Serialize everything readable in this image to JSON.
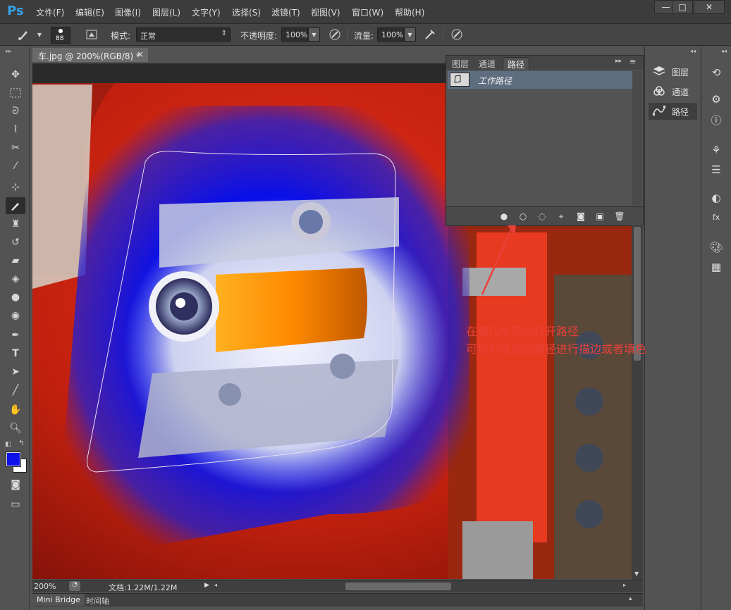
{
  "app": {
    "logo": "Ps"
  },
  "menu": [
    "文件(F)",
    "编辑(E)",
    "图像(I)",
    "图层(L)",
    "文字(Y)",
    "选择(S)",
    "滤镜(T)",
    "视图(V)",
    "窗口(W)",
    "帮助(H)"
  ],
  "window_controls": {
    "minimize": "—",
    "maximize": "□",
    "close": "✕"
  },
  "options": {
    "brush_size": "88",
    "mode_label": "模式:",
    "mode_value": "正常",
    "opacity_label": "不透明度:",
    "opacity_value": "100%",
    "flow_label": "流量:",
    "flow_value": "100%"
  },
  "document": {
    "tab_title": "车.jpg @ 200%(RGB/8) *",
    "tab_close": "×",
    "zoom": "200%",
    "doc_info": "文档:1.22M/1.22M"
  },
  "paths_panel": {
    "tabs": [
      "图层",
      "通道",
      "路径"
    ],
    "active_tab": "路径",
    "path_name": "工作路径",
    "footer_icons": [
      "fill-path",
      "stroke-path",
      "load-selection",
      "make-work-path",
      "add-mask",
      "new-path",
      "delete-path"
    ]
  },
  "dock": {
    "items": [
      {
        "label": "图层",
        "icon": "layers-icon"
      },
      {
        "label": "通道",
        "icon": "channels-icon"
      },
      {
        "label": "路径",
        "icon": "paths-icon"
      }
    ]
  },
  "bottom_tabs": [
    "Mini Bridge",
    "时间轴"
  ],
  "annotation": {
    "line1": "在窗口中可以打开路径",
    "line2": "可以对绘话的路径进行描边或者填色"
  },
  "colors": {
    "foreground": "#1010e8",
    "background": "#ffffff",
    "annotation": "#e8413a",
    "accent": "#35a0e6"
  }
}
